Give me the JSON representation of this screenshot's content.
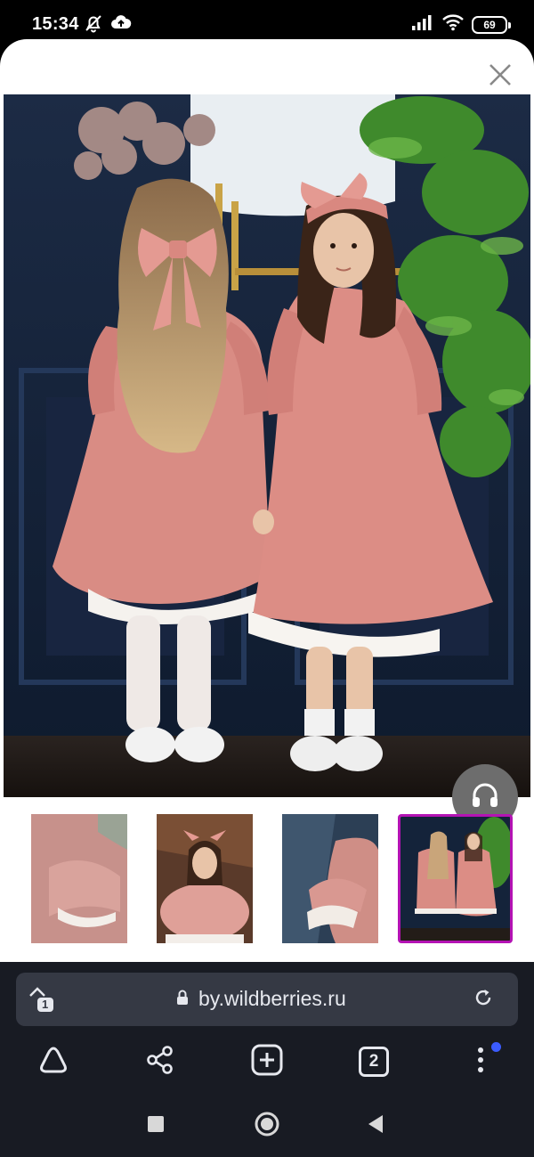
{
  "status_bar": {
    "time": "15:34",
    "battery": "69",
    "left_icons": [
      "alarm-off-icon",
      "cloud-upload-icon"
    ],
    "right_icons": [
      "signal-icon",
      "wifi-icon",
      "battery-icon"
    ]
  },
  "viewer": {
    "close_icon": "close-icon",
    "assistant_icon": "headphones-icon",
    "thumbnails": [
      {
        "name": "thumbnail-sleeve-detail",
        "selected": false
      },
      {
        "name": "thumbnail-girl-sitting",
        "selected": false
      },
      {
        "name": "thumbnail-cuff-detail",
        "selected": false
      },
      {
        "name": "thumbnail-two-girls",
        "selected": true
      }
    ]
  },
  "browser": {
    "url": "by.wildberries.ru",
    "tabs_badge": "1",
    "tab_count": "2",
    "toolbar_icons": [
      "home-icon",
      "share-icon",
      "new-tab-icon",
      "tabs-icon",
      "menu-icon"
    ]
  },
  "colors": {
    "accent_selected": "#b413b4",
    "browser_bg": "#181b23",
    "url_bar_bg": "#353944",
    "notification_dot": "#3b5cff"
  }
}
